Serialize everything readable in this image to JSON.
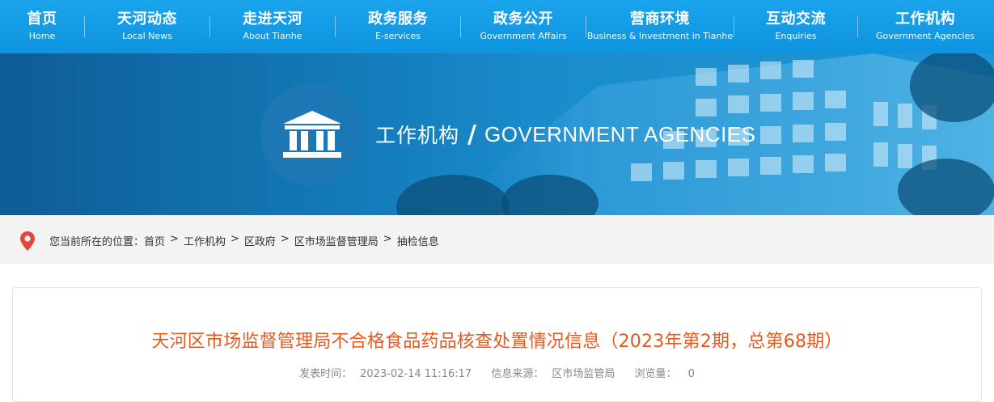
{
  "nav": {
    "items": [
      {
        "zh": "首页",
        "en": "Home"
      },
      {
        "zh": "天河动态",
        "en": "Local News"
      },
      {
        "zh": "走进天河",
        "en": "About Tianhe"
      },
      {
        "zh": "政务服务",
        "en": "E-services"
      },
      {
        "zh": "政务公开",
        "en": "Government Affairs"
      },
      {
        "zh": "营商环境",
        "en": "Business & Investment in Tianhe"
      },
      {
        "zh": "互动交流",
        "en": "Enquiries"
      },
      {
        "zh": "工作机构",
        "en": "Government Agencies"
      }
    ]
  },
  "banner": {
    "title_zh": "工作机构",
    "slash": "/",
    "title_en": "GOVERNMENT AGENCIES",
    "icon": "government-building-icon"
  },
  "breadcrumb": {
    "prefix": "您当前所在的位置：",
    "items": [
      "首页",
      "工作机构",
      "区政府",
      "区市场监督管理局",
      "抽检信息"
    ],
    "separator": ">",
    "icon": "location-pin-icon"
  },
  "article": {
    "title": "天河区市场监督管理局不合格食品药品核查处置情况信息（2023年第2期，总第68期）",
    "publish_label": "发表时间：",
    "publish_time": "2023-02-14 11:16:17",
    "source_label": "信息来源：",
    "source": "区市场监管局",
    "views_label": "浏览量：",
    "views": "0"
  },
  "colors": {
    "nav_bg": "#15a0ea",
    "title_orange": "#e8591f",
    "pin_red": "#e5473c",
    "breadcrumb_bg": "#f3f3f3"
  }
}
